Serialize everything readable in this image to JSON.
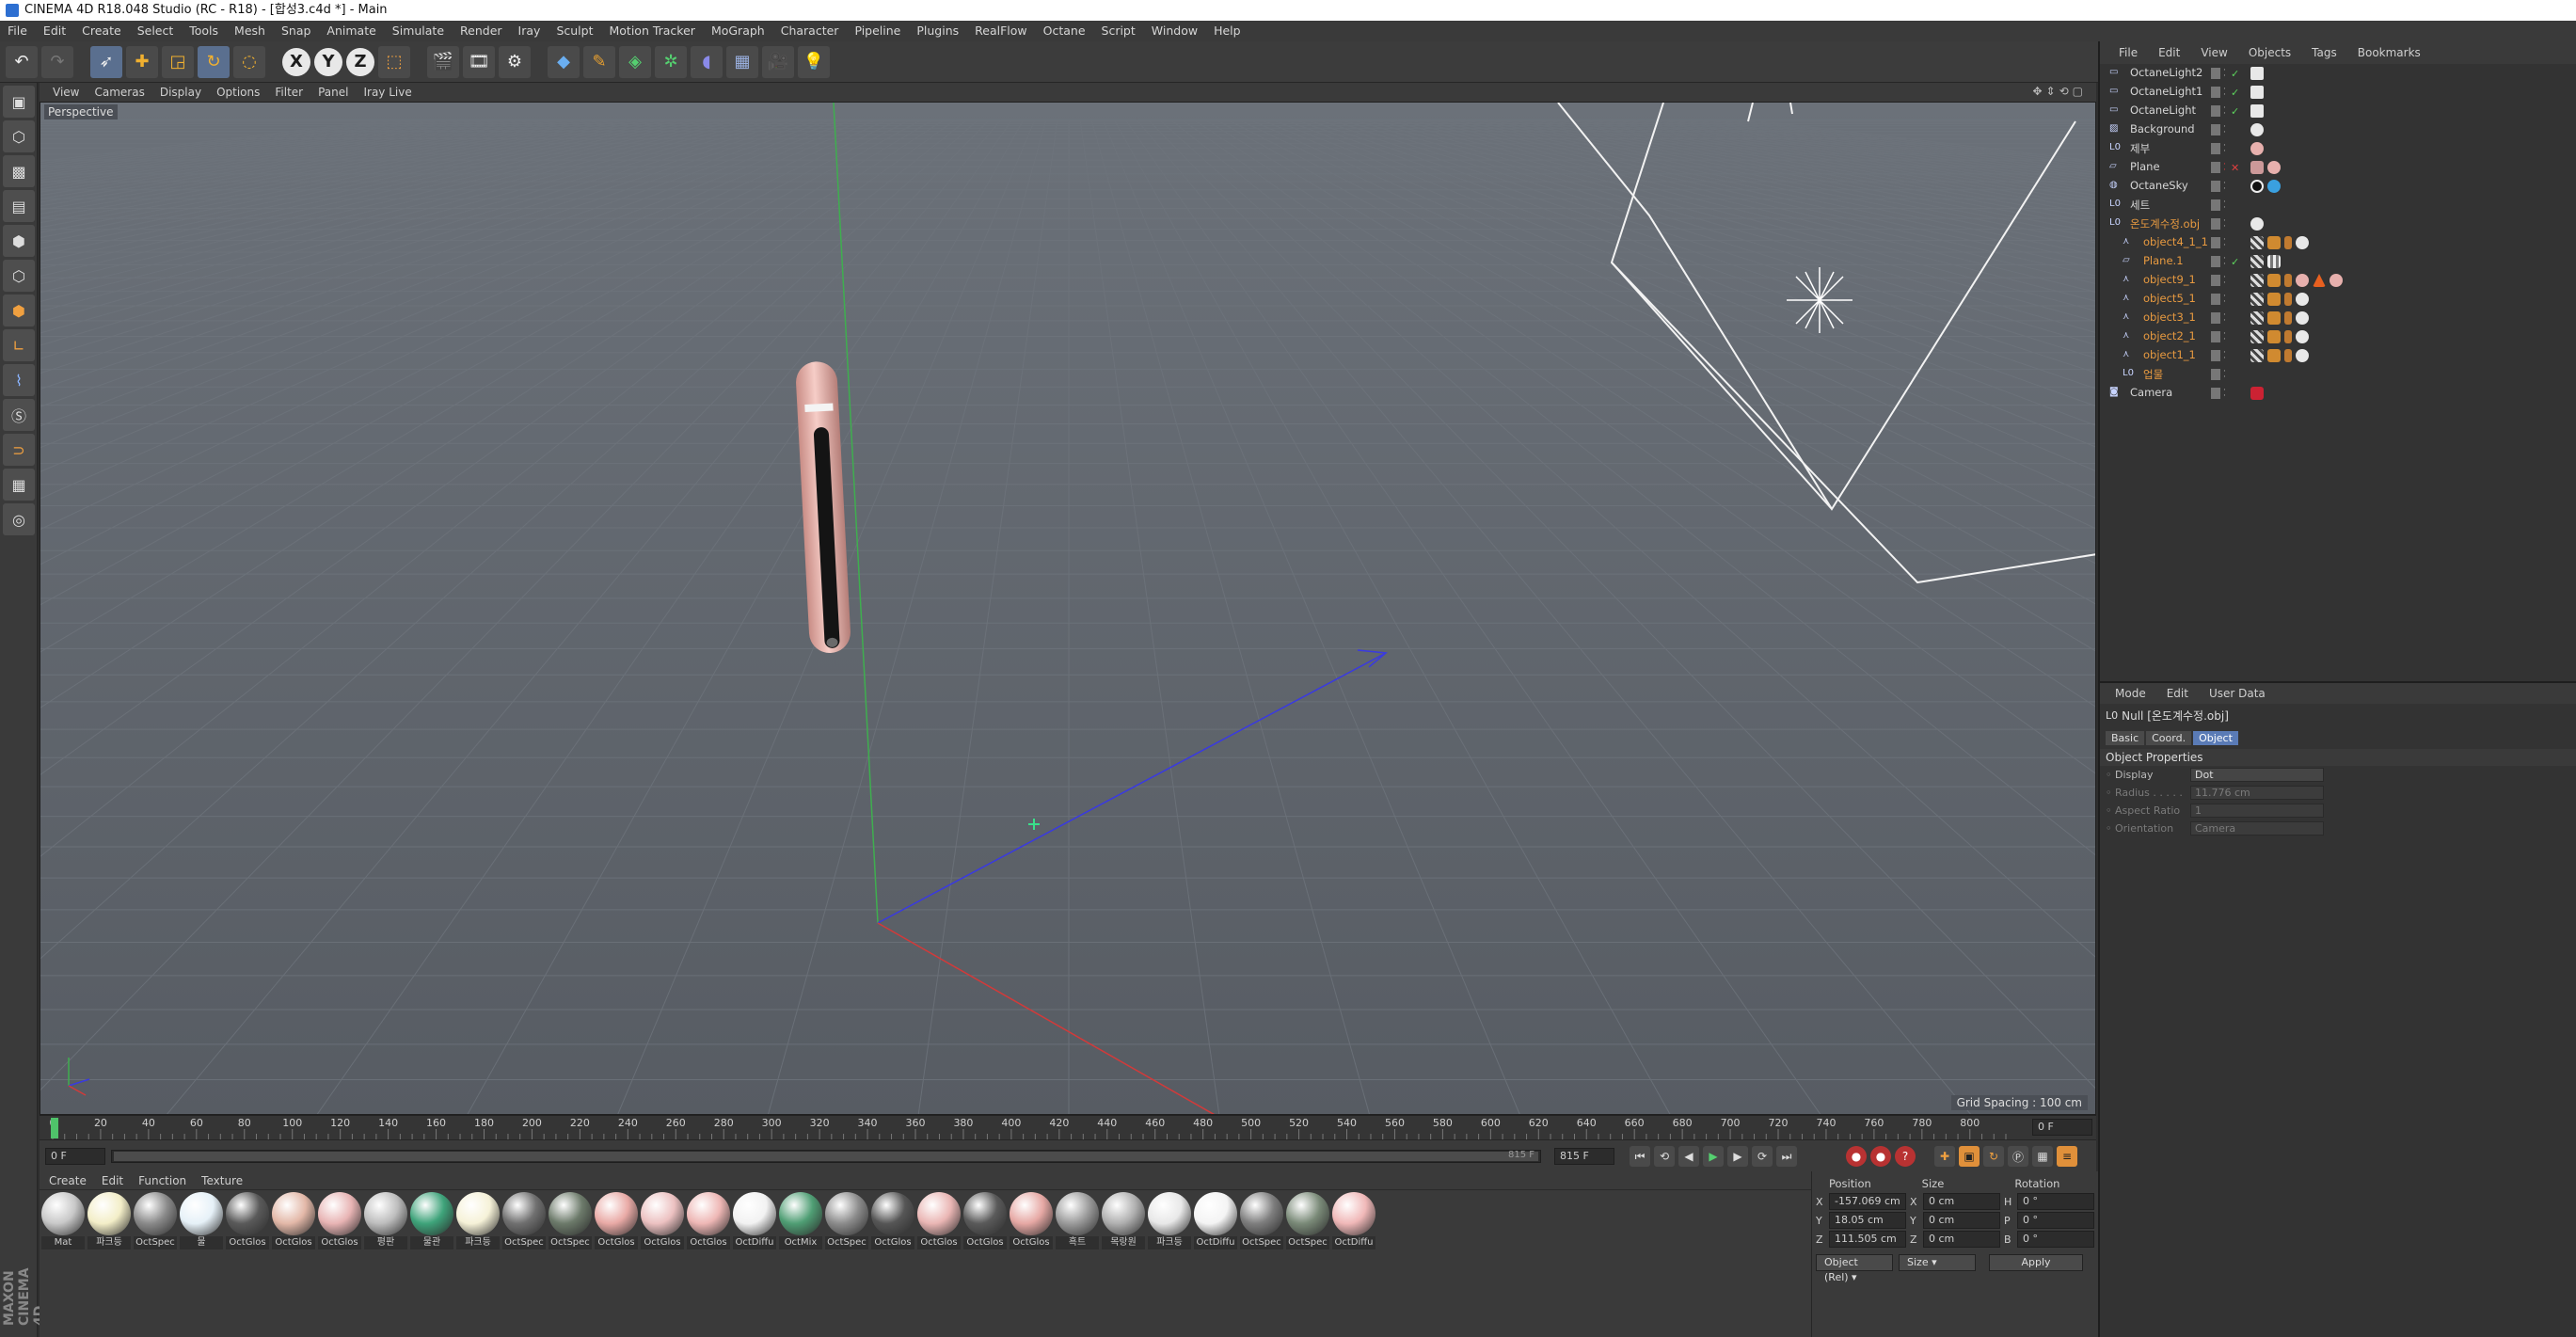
{
  "window": {
    "title": "CINEMA 4D R18.048 Studio (RC - R18) - [합성3.c4d *] - Main"
  },
  "menu": [
    "File",
    "Edit",
    "Create",
    "Select",
    "Tools",
    "Mesh",
    "Snap",
    "Animate",
    "Simulate",
    "Render",
    "Iray",
    "Sculpt",
    "Motion Tracker",
    "MoGraph",
    "Character",
    "Pipeline",
    "Plugins",
    "RealFlow",
    "Octane",
    "Script",
    "Window",
    "Help"
  ],
  "toolbar": {
    "axis_x": "X",
    "axis_y": "Y",
    "axis_z": "Z",
    "icons": [
      "undo-icon",
      "redo-icon",
      "select-arrow-icon",
      "move-icon",
      "scale-icon",
      "rotate-icon",
      "live-select-icon",
      "axis-x",
      "axis-y",
      "axis-z",
      "coordinate-system-icon",
      "render-view-icon",
      "render-picture-viewer-icon",
      "edit-render-settings-icon",
      "cube-icon",
      "pen-icon",
      "subdivision-icon",
      "cloner-icon",
      "deformer-icon",
      "floor-icon",
      "camera-icon",
      "light-icon"
    ]
  },
  "viewport": {
    "menu": [
      "View",
      "Cameras",
      "Display",
      "Options",
      "Filter",
      "Panel",
      "Iray Live"
    ],
    "label": "Perspective",
    "grid_spacing": "Grid Spacing : 100 cm"
  },
  "timeline": {
    "ticks": [
      "0",
      "20",
      "40",
      "60",
      "80",
      "100",
      "120",
      "140",
      "160",
      "180",
      "200",
      "220",
      "240",
      "260",
      "280",
      "300",
      "320",
      "340",
      "360",
      "380",
      "400",
      "420",
      "440",
      "460",
      "480",
      "500",
      "520",
      "540",
      "560",
      "580",
      "600",
      "620",
      "640",
      "660",
      "680",
      "700",
      "720",
      "740",
      "760",
      "780",
      "800"
    ],
    "current_frame": "0 F",
    "start": "0 F",
    "end": "815 F",
    "end_field": "815 F",
    "range_label": "0 F"
  },
  "materials": {
    "menu": [
      "Create",
      "Edit",
      "Function",
      "Texture"
    ],
    "items": [
      {
        "label": "Mat",
        "color": "#c8c8c8"
      },
      {
        "label": "파크등",
        "color": "#f3eec8"
      },
      {
        "label": "OctSpec",
        "color": "#8a8a8a"
      },
      {
        "label": "물",
        "color": "#e6f1f8"
      },
      {
        "label": "OctGlos",
        "color": "#5a5a5a"
      },
      {
        "label": "OctGlos",
        "color": "#e3b8a8"
      },
      {
        "label": "OctGlos",
        "color": "#e8b4b4"
      },
      {
        "label": "평판",
        "color": "#bdbdbd"
      },
      {
        "label": "물관",
        "color": "#3ea37a"
      },
      {
        "label": "파크등",
        "color": "#f6f2d8"
      },
      {
        "label": "OctSpec",
        "color": "#707070"
      },
      {
        "label": "OctSpec",
        "color": "#6c7a6a"
      },
      {
        "label": "OctGlos",
        "color": "#e9aaa6"
      },
      {
        "label": "OctGlos",
        "color": "#ecc1c1"
      },
      {
        "label": "OctGlos",
        "color": "#eeb7b5"
      },
      {
        "label": "OctDiffu",
        "color": "#f2f2f2"
      },
      {
        "label": "OctMix",
        "color": "#4f9e74"
      },
      {
        "label": "OctSpec",
        "color": "#8c8c8c"
      },
      {
        "label": "OctGlos",
        "color": "#565656"
      },
      {
        "label": "OctGlos",
        "color": "#eab6b4"
      },
      {
        "label": "OctGlos",
        "color": "#5a5a5a"
      },
      {
        "label": "OctGlos",
        "color": "#e6a8a4"
      },
      {
        "label": "흑트",
        "color": "#9b9b9b"
      },
      {
        "label": "목랑원",
        "color": "#b0b0b0"
      },
      {
        "label": "파크등",
        "color": "#e8e8e8"
      },
      {
        "label": "OctDiffu",
        "color": "#f4f4f4"
      },
      {
        "label": "OctSpec",
        "color": "#7e7e7e"
      },
      {
        "label": "OctSpec",
        "color": "#7a8a78"
      },
      {
        "label": "OctDiffu",
        "color": "#f0b8b8"
      }
    ]
  },
  "coords": {
    "headers": [
      "Position",
      "Size",
      "Rotation"
    ],
    "rows": [
      {
        "axis": "X",
        "pos": "-157.069 cm",
        "size_axis": "X",
        "size": "0 cm",
        "rot_axis": "H",
        "rot": "0 °"
      },
      {
        "axis": "Y",
        "pos": "18.05 cm",
        "size_axis": "Y",
        "size": "0 cm",
        "rot_axis": "P",
        "rot": "0 °"
      },
      {
        "axis": "Z",
        "pos": "111.505 cm",
        "size_axis": "Z",
        "size": "0 cm",
        "rot_axis": "B",
        "rot": "0 °"
      }
    ],
    "mode_dropdown": "Object (Rel)",
    "size_dropdown": "Size",
    "apply": "Apply"
  },
  "object_manager": {
    "menu": [
      "File",
      "Edit",
      "View",
      "Objects",
      "Tags",
      "Bookmarks"
    ],
    "objects": [
      {
        "name": "OctaneLight2",
        "indent": 0,
        "type": "light",
        "orange": false,
        "tags": "light"
      },
      {
        "name": "OctaneLight1",
        "indent": 0,
        "type": "light",
        "orange": false,
        "tags": "light"
      },
      {
        "name": "OctaneLight",
        "indent": 0,
        "type": "light",
        "orange": false,
        "tags": "light"
      },
      {
        "name": "Background",
        "indent": 0,
        "type": "bg",
        "orange": false,
        "tags": "white"
      },
      {
        "name": "제부",
        "indent": 0,
        "type": "null",
        "orange": false,
        "tags": "pink"
      },
      {
        "name": "Plane",
        "indent": 0,
        "type": "plane",
        "orange": false,
        "tags": "pinkmulti"
      },
      {
        "name": "OctaneSky",
        "indent": 0,
        "type": "sky",
        "orange": false,
        "tags": "sky"
      },
      {
        "name": "세트",
        "indent": 0,
        "type": "null",
        "orange": false,
        "tags": "none"
      },
      {
        "name": "온도계수정.obj",
        "indent": 0,
        "type": "null",
        "orange": true,
        "tags": "white"
      },
      {
        "name": "object4_1_1",
        "indent": 1,
        "type": "poly",
        "orange": true,
        "tags": "multi"
      },
      {
        "name": "Plane.1",
        "indent": 1,
        "type": "plane",
        "orange": true,
        "tags": "multi2"
      },
      {
        "name": "object9_1",
        "indent": 1,
        "type": "poly",
        "orange": true,
        "tags": "multi3"
      },
      {
        "name": "object5_1",
        "indent": 1,
        "type": "poly",
        "orange": true,
        "tags": "multi"
      },
      {
        "name": "object3_1",
        "indent": 1,
        "type": "poly",
        "orange": true,
        "tags": "multi"
      },
      {
        "name": "object2_1",
        "indent": 1,
        "type": "poly",
        "orange": true,
        "tags": "multi"
      },
      {
        "name": "object1_1",
        "indent": 1,
        "type": "poly",
        "orange": true,
        "tags": "multi"
      },
      {
        "name": "업물",
        "indent": 1,
        "type": "null",
        "orange": true,
        "tags": "none"
      },
      {
        "name": "Camera",
        "indent": 0,
        "type": "camera",
        "orange": false,
        "tags": "camera"
      }
    ]
  },
  "attributes": {
    "menu": [
      "Mode",
      "Edit",
      "User Data"
    ],
    "header": "Null [온도계수정.obj]",
    "tabs": [
      "Basic",
      "Coord.",
      "Object"
    ],
    "section": "Object Properties",
    "props": [
      {
        "label": "Display",
        "value": "Dot",
        "dim": false
      },
      {
        "label": "Radius . . . . .",
        "value": "11.776 cm",
        "dim": true
      },
      {
        "label": "Aspect Ratio",
        "value": "1",
        "dim": true
      },
      {
        "label": "Orientation",
        "value": "Camera",
        "dim": true
      }
    ]
  },
  "maxon_logo": "MAXON CINEMA 4D"
}
